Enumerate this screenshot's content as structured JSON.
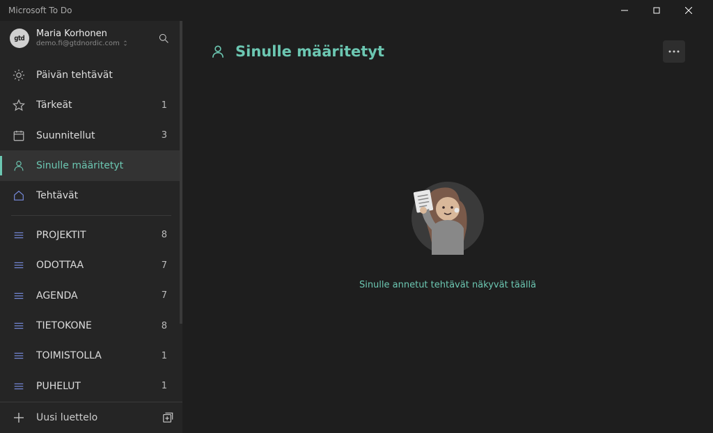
{
  "app_title": "Microsoft To Do",
  "user": {
    "name": "Maria Korhonen",
    "email": "demo.fi@gtdnordic.com",
    "avatar_text": "gtd"
  },
  "smart_lists": [
    {
      "key": "myday",
      "label": "Päivän tehtävät",
      "count": ""
    },
    {
      "key": "important",
      "label": "Tärkeät",
      "count": "1"
    },
    {
      "key": "planned",
      "label": "Suunnitellut",
      "count": "3"
    },
    {
      "key": "assigned",
      "label": "Sinulle määritetyt",
      "count": "",
      "active": true
    },
    {
      "key": "tasks",
      "label": "Tehtävät",
      "count": ""
    }
  ],
  "custom_lists": [
    {
      "label": "PROJEKTIT",
      "count": "8"
    },
    {
      "label": "ODOTTAA",
      "count": "7"
    },
    {
      "label": "AGENDA",
      "count": "7"
    },
    {
      "label": "TIETOKONE",
      "count": "8"
    },
    {
      "label": "TOIMISTOLLA",
      "count": "1"
    },
    {
      "label": "PUHELUT",
      "count": "1"
    }
  ],
  "new_list_label": "Uusi luettelo",
  "main": {
    "title": "Sinulle määritetyt",
    "empty_text": "Sinulle annetut tehtävät näkyvät täällä"
  }
}
